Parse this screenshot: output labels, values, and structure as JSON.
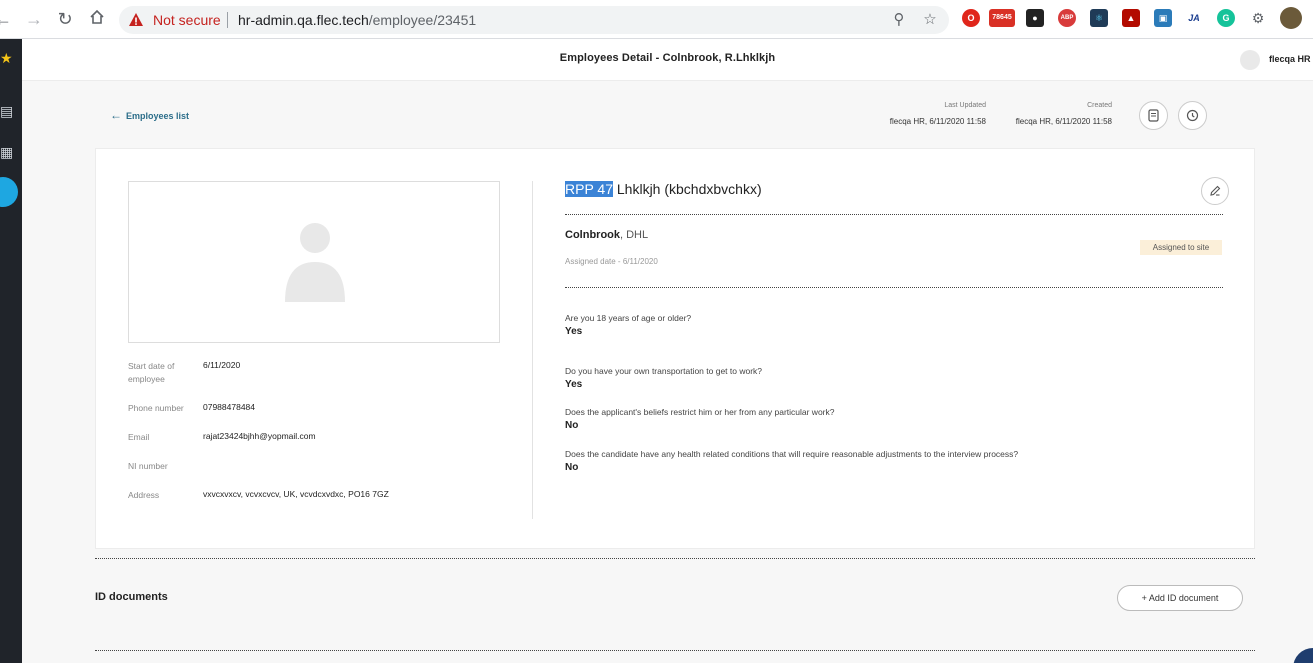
{
  "browser": {
    "security_label": "Not secure",
    "url_host": "hr-admin.qa.flec.tech",
    "url_path": "/employee/23451",
    "gmail_badge": "78645",
    "ext_abp": "ABP",
    "ext_ja": "JA"
  },
  "header": {
    "title": "Employees Detail - Colnbrook, R.Lhklkjh",
    "user_name": "flecqa HR"
  },
  "breadcrumb": {
    "back_label": "Employees list"
  },
  "meta": {
    "last_updated_label": "Last Updated",
    "last_updated_value": "flecqa HR, 6/11/2020 11:58",
    "created_label": "Created",
    "created_value": "flecqa HR, 6/11/2020 11:58"
  },
  "employee": {
    "name_highlight": "RPP 47",
    "name_rest": " Lhklkjh (kbchdxbvchkx)",
    "site": "Colnbrook",
    "site_sub": ", DHL",
    "assigned_date": "Assigned date - 6/11/2020",
    "status_badge": "Assigned to site"
  },
  "details": [
    {
      "label": "Start date of employee",
      "value": "6/11/2020"
    },
    {
      "label": "Phone number",
      "value": "07988478484"
    },
    {
      "label": "Email",
      "value": "rajat23424bjhh@yopmail.com"
    },
    {
      "label": "NI number",
      "value": ""
    },
    {
      "label": "Address",
      "value": "vxvcxvxcv, vcvxcvcv, UK, vcvdcxvdxc, PO16 7GZ"
    }
  ],
  "questions": [
    {
      "q": "Are you 18 years of age or older?",
      "a": "Yes"
    },
    {
      "q": "Do you have your own transportation to get to work?",
      "a": "Yes"
    },
    {
      "q": "Does the applicant's beliefs restrict him or her from any particular work?",
      "a": "No"
    },
    {
      "q": "Does the candidate have any health related conditions that will require reasonable adjustments to the interview process?",
      "a": "No"
    }
  ],
  "id_documents": {
    "title": "ID documents",
    "add_button": "Add ID document"
  },
  "colors": {
    "accent": "#2c6e8a",
    "highlight": "#3b83d6",
    "badge_bg": "#fbefd9",
    "sidebar": "#20242a"
  }
}
